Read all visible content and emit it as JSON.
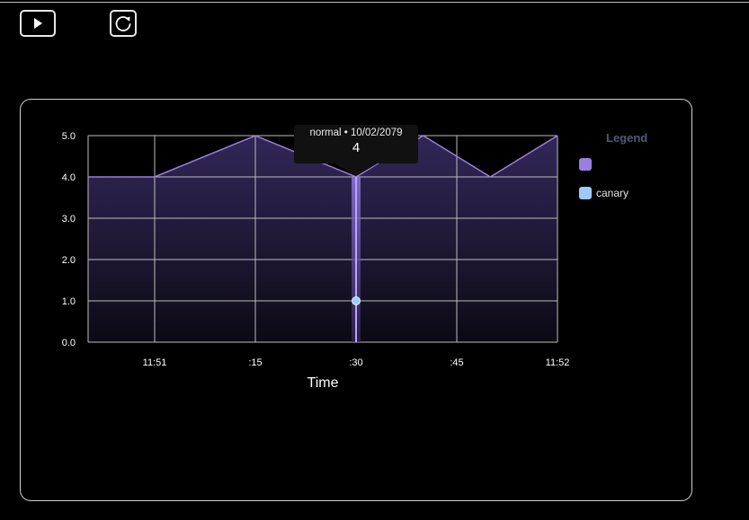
{
  "toolbar": {
    "play_icon": "play-icon",
    "reload_icon": "reload-icon"
  },
  "colors": {
    "background": "#000000",
    "series_normal": "#9b7fe0",
    "series_canary": "#9ecbff",
    "legend_title": "#4e5a76"
  },
  "chart_data": {
    "type": "area",
    "xlabel": "Time",
    "ylabel": "",
    "x_ticks": [
      "11:51",
      ":15",
      ":30",
      ":45",
      "11:52"
    ],
    "y_ticks": [
      "0.0",
      "1.0",
      "2.0",
      "3.0",
      "4.0",
      "5.0"
    ],
    "ylim": [
      0,
      5
    ],
    "xlim": [
      "11:51:00",
      "11:52:00"
    ],
    "grid": true,
    "legend_placement": "right",
    "legend_title": "Legend",
    "series": [
      {
        "name": "",
        "color": "#9b7fe0",
        "x": [
          "11:50:45",
          "11:51:00",
          "11:51:15",
          "11:51:30",
          "11:51:40",
          "11:51:50",
          "11:52:00"
        ],
        "values": [
          4,
          4,
          5,
          4,
          5,
          4,
          5
        ]
      },
      {
        "name": "canary",
        "color": "#9ecbff",
        "x": [
          "11:51:30"
        ],
        "values": [
          1
        ]
      }
    ],
    "highlight_x": "11:51:30",
    "tooltip": {
      "title": "normal • 10/02/2079",
      "value": "4"
    }
  }
}
